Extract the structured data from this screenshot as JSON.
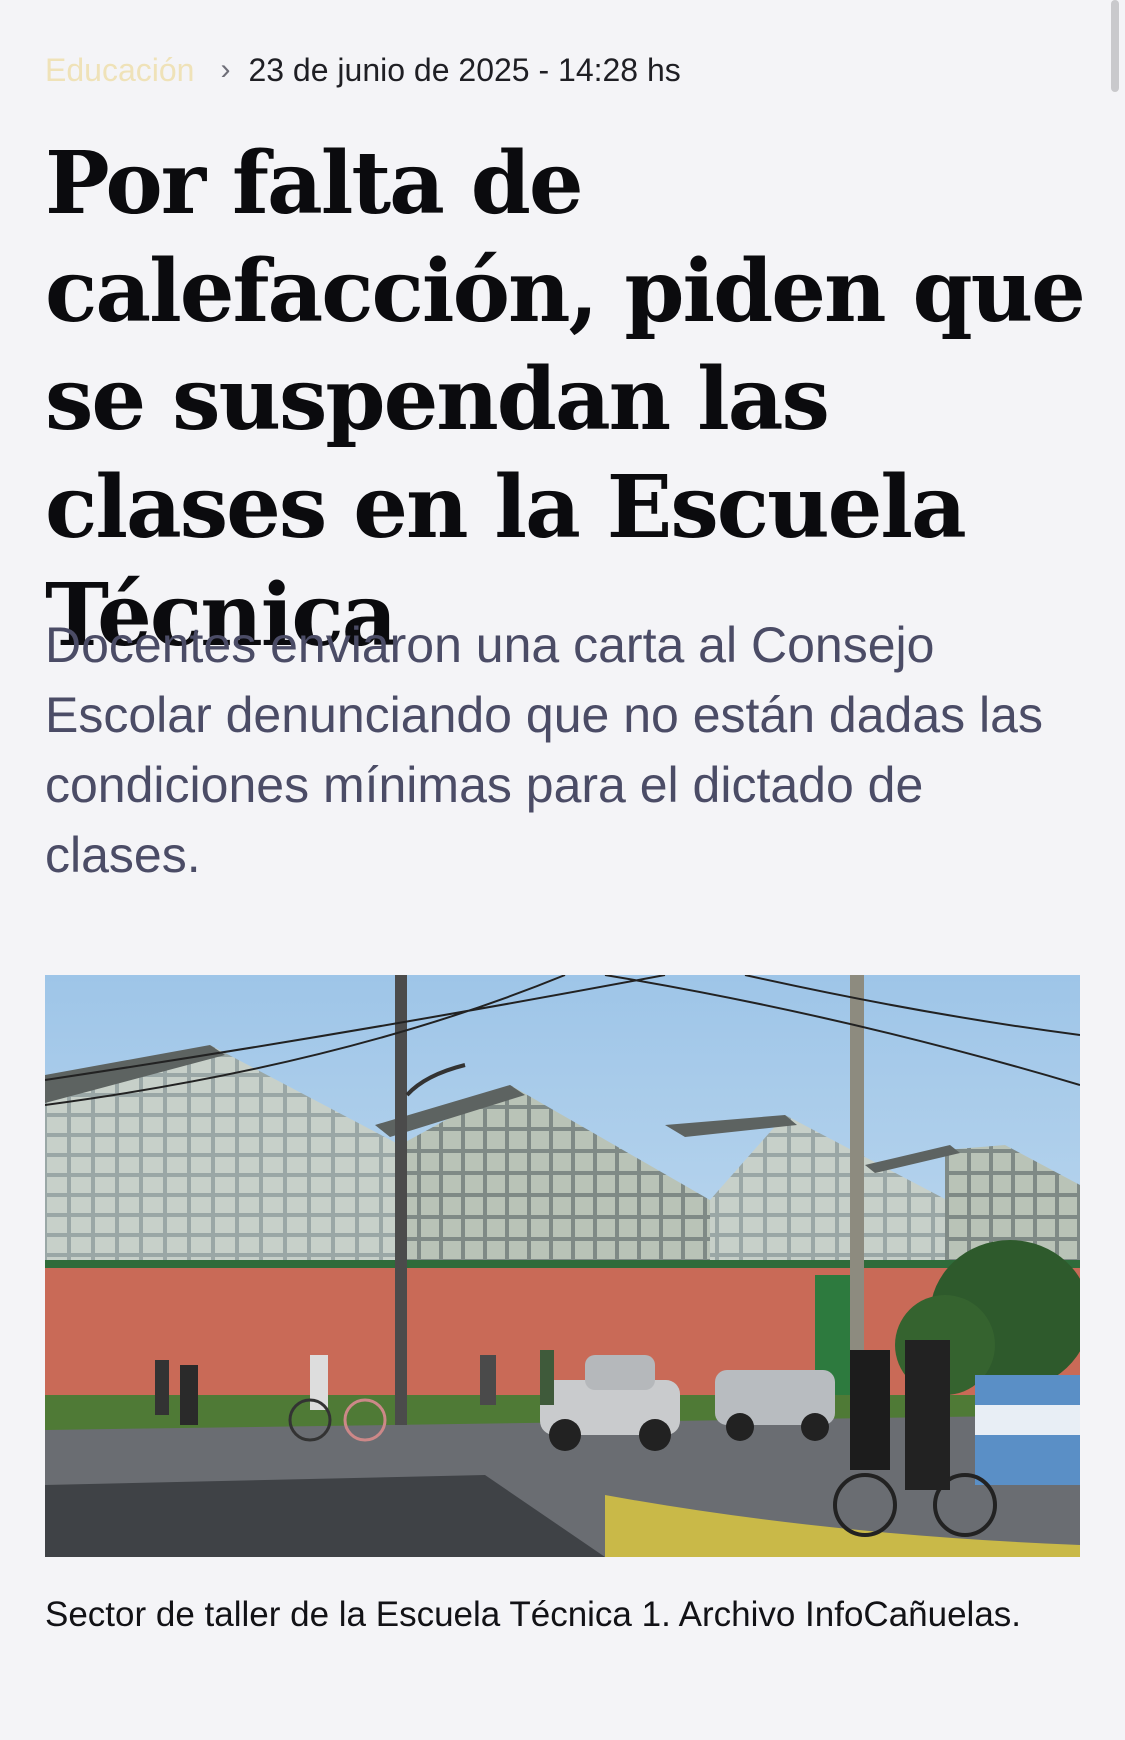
{
  "article": {
    "category": "Educación",
    "date": "23 de junio de 2025 - 14:28 hs",
    "headline": "Por falta de calefacción, piden que se suspendan las clases en la Escuela Técnica",
    "subheadline": "Docentes enviaron una carta al Consejo Escolar denunciando que no están dadas las condiciones mínimas para el dictado de clases.",
    "image_caption": "Sector de taller de la Escuela Técnica 1. Archivo InfoCañuelas.",
    "image_alt": "Sector de taller de la Escuela Técnica 1"
  },
  "colors": {
    "background": "#f4f4f7",
    "category": "#efe2b8",
    "headline": "#0b0b0e",
    "subheadline": "#4b4c66"
  },
  "icons": {
    "breadcrumb_separator": "chevron-right-icon"
  }
}
